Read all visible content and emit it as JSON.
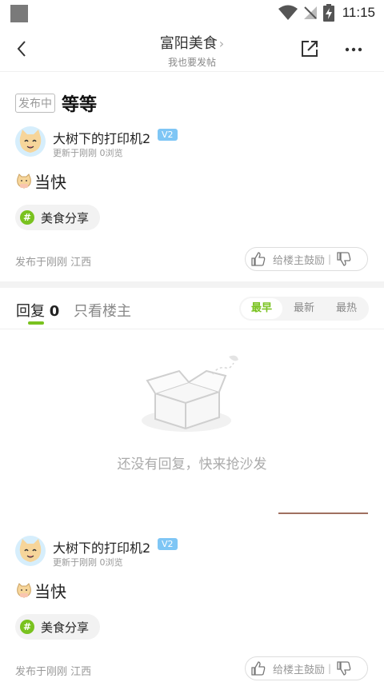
{
  "status_bar": {
    "time": "11:15"
  },
  "nav": {
    "title": "富阳美食",
    "title_chevron": "›",
    "subtitle": "我也要发帖"
  },
  "post": {
    "status_tag": "发布中",
    "title": "等等",
    "author": {
      "name": "大树下的打印机2",
      "level": "V2",
      "meta": "更新于刚刚  0浏览"
    },
    "content": "当快",
    "topic": {
      "icon": "#",
      "label": "美食分享"
    },
    "pub_info": "发布于刚刚  江西",
    "encourage_label": "给楼主鼓励",
    "encourage_sep": "|"
  },
  "replies": {
    "tab_label": "回复",
    "count": "0",
    "owner_only": "只看楼主",
    "sort_options": [
      "最早",
      "最新",
      "最热"
    ],
    "sort_active": "最早",
    "empty_text": "还没有回复，快来抢沙发"
  },
  "colors": {
    "accent": "#79c21f",
    "badge": "#7fc6f5"
  },
  "icons": [
    "back-arrow-icon",
    "chevron-right-icon",
    "share-icon",
    "more-icon",
    "thumbs-up-icon",
    "thumbs-down-icon",
    "topic-hash-icon",
    "empty-box-icon",
    "wifi-icon",
    "no-signal-icon",
    "battery-icon"
  ]
}
